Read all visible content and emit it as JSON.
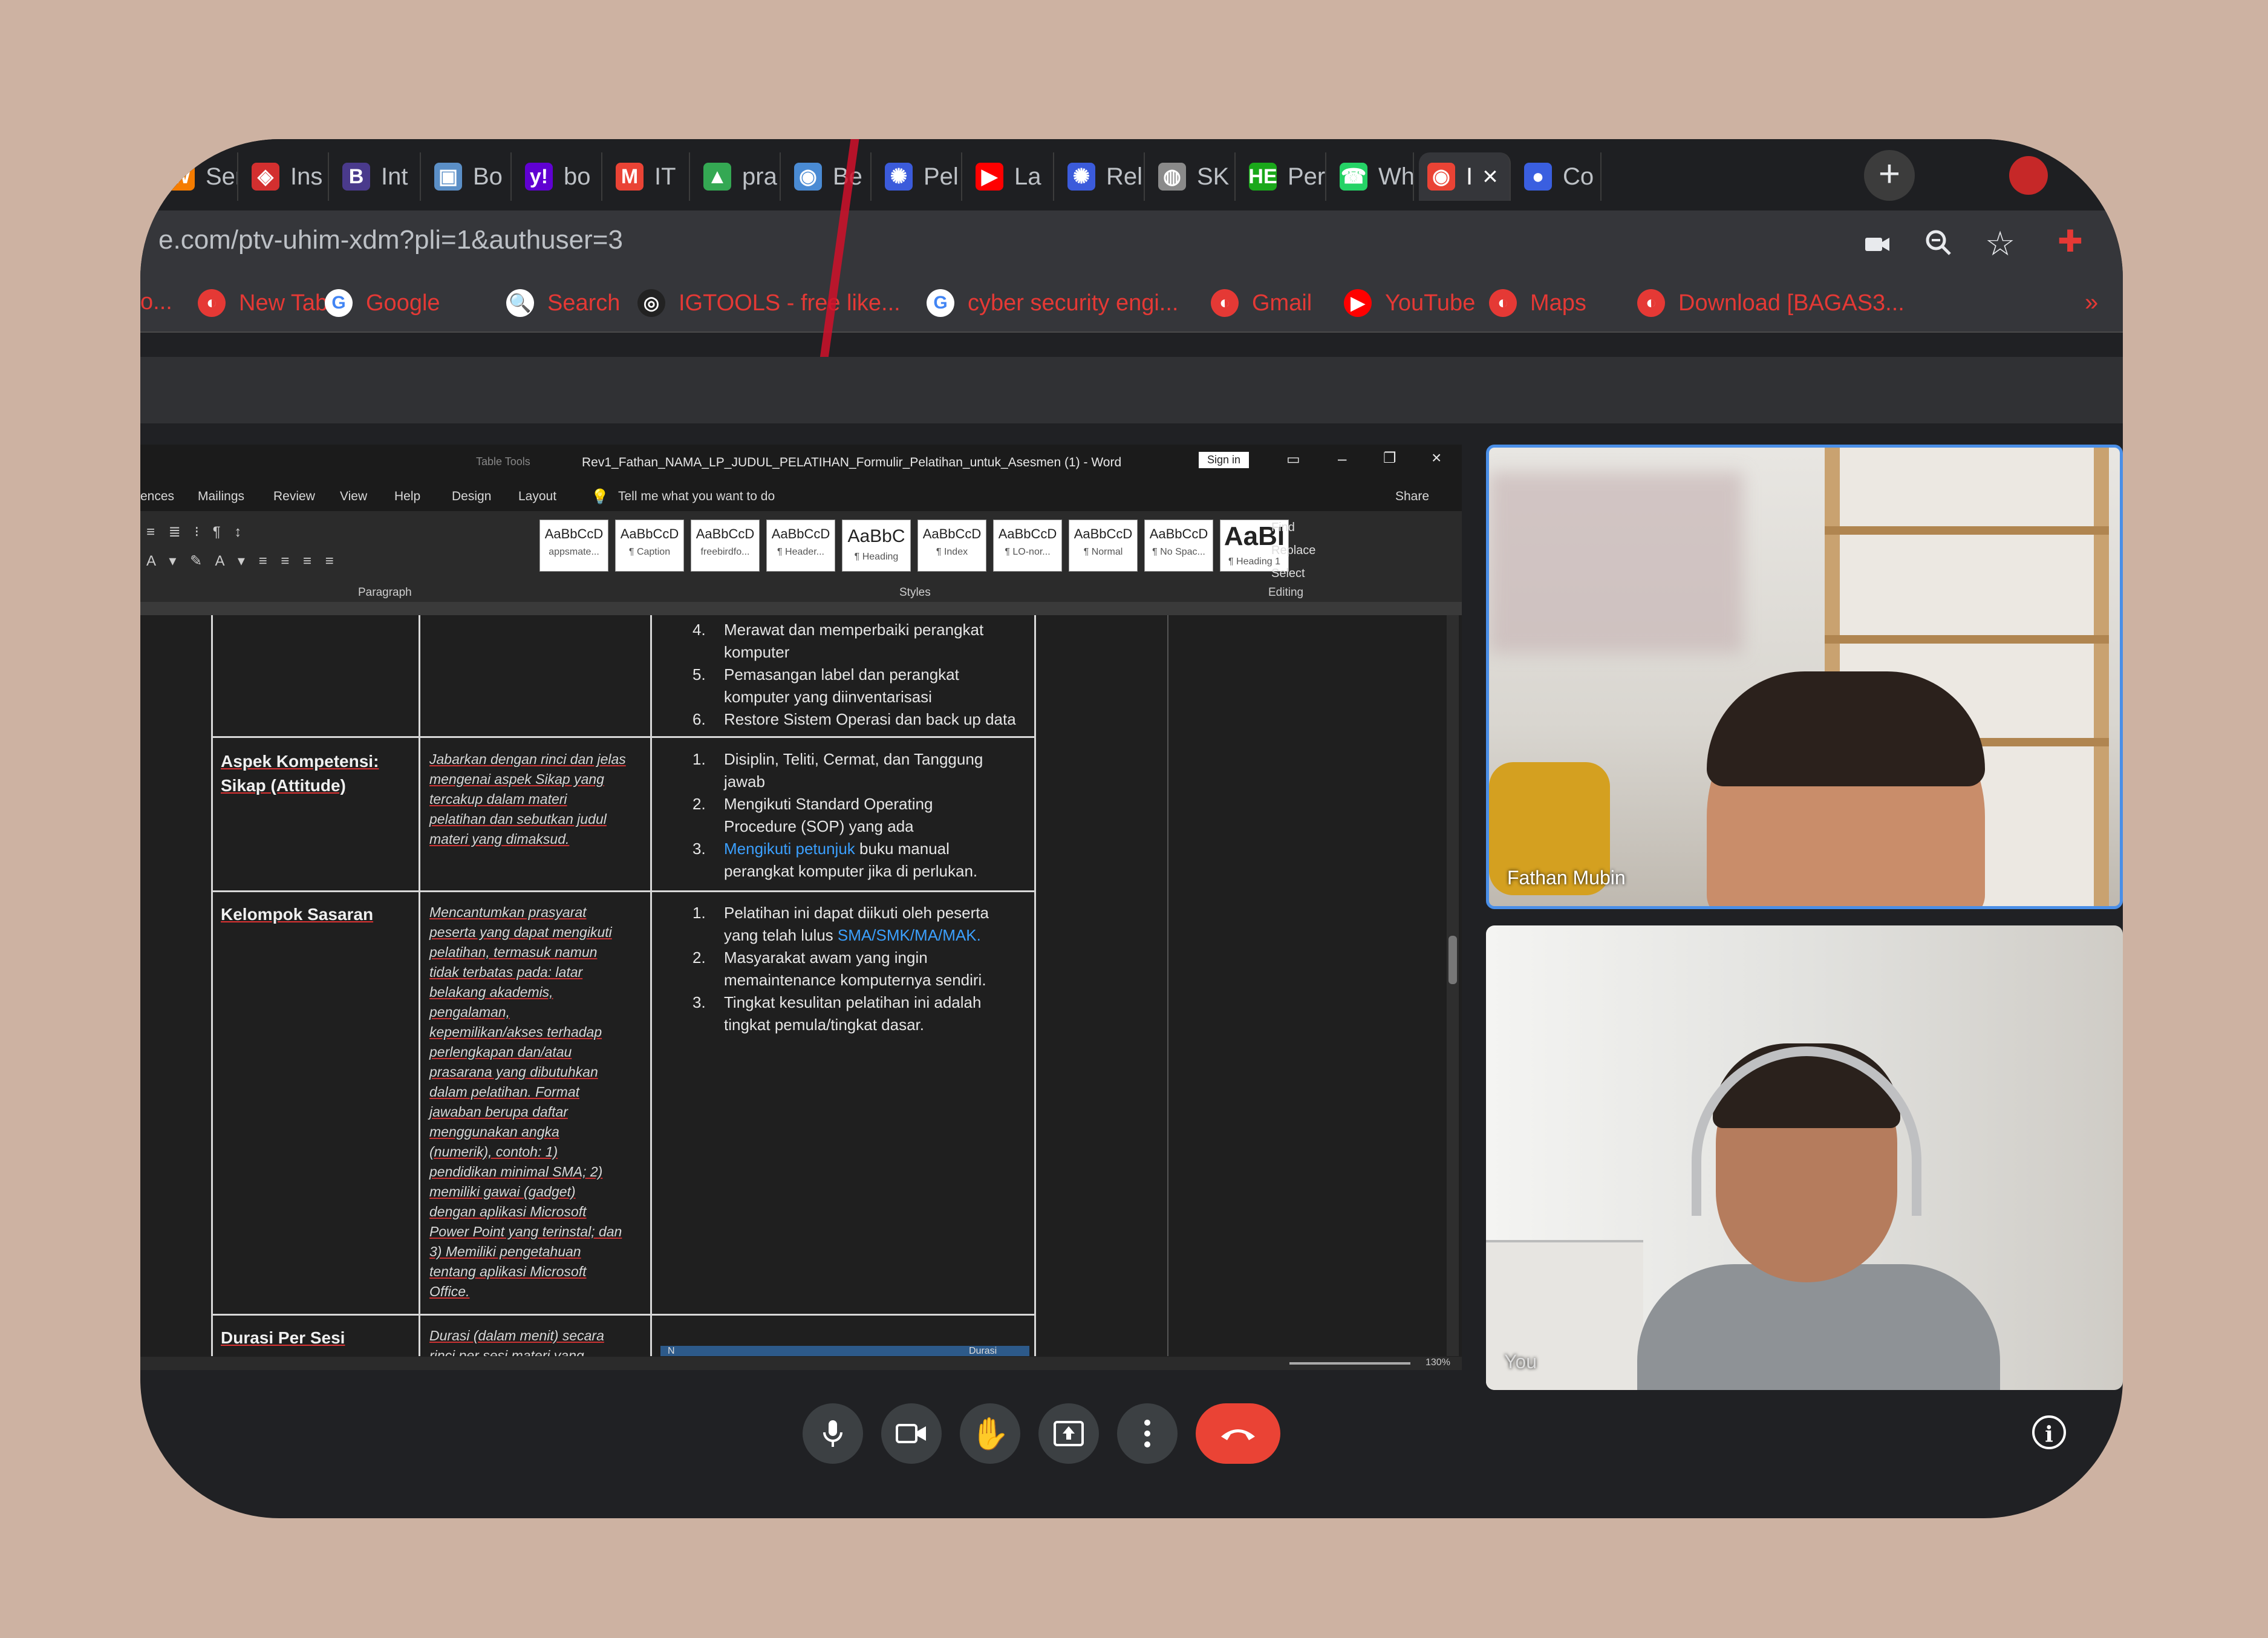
{
  "tabs": [
    {
      "label": "Ser",
      "icon": "ser-icon",
      "color": "#f57c00",
      "glyph": "W"
    },
    {
      "label": "Ins",
      "icon": "laravel-icon",
      "color": "#d32f2f",
      "glyph": "◈"
    },
    {
      "label": "Int",
      "icon": "bootstrap-icon",
      "color": "#4a3a8c",
      "glyph": "B"
    },
    {
      "label": "Bo",
      "icon": "box-icon",
      "color": "#5b8fc7",
      "glyph": "▣"
    },
    {
      "label": "bo",
      "icon": "yahoo-icon",
      "color": "#6001d2",
      "glyph": "y!"
    },
    {
      "label": "IT",
      "icon": "gmail-icon",
      "color": "#ea4335",
      "glyph": "M"
    },
    {
      "label": "pra",
      "icon": "drive-icon",
      "color": "#34a853",
      "glyph": "▲"
    },
    {
      "label": "Be",
      "icon": "maps-pin-icon",
      "color": "#4a8bd4",
      "glyph": "◉"
    },
    {
      "label": "Pel",
      "icon": "globe-blue-icon",
      "color": "#3b5bdb",
      "glyph": "✺"
    },
    {
      "label": "La",
      "icon": "youtube-icon",
      "color": "#ff0000",
      "glyph": "▶"
    },
    {
      "label": "Rel",
      "icon": "globe-blue-icon",
      "color": "#3b5bdb",
      "glyph": "✺"
    },
    {
      "label": "SK",
      "icon": "globe-gray-icon",
      "color": "#8a8a8a",
      "glyph": "◍"
    },
    {
      "label": "Per",
      "icon": "he-icon",
      "color": "#1aa81a",
      "glyph": "HE"
    },
    {
      "label": "Wh",
      "icon": "whatsapp-icon",
      "color": "#25d366",
      "glyph": "☎"
    },
    {
      "label": "I",
      "icon": "record-icon",
      "color": "#ea4335",
      "glyph": "◉",
      "active": true
    },
    {
      "label": "Co",
      "icon": "blob-icon",
      "color": "#3a5fe0",
      "glyph": "●"
    }
  ],
  "tab_close": "×",
  "new_tab": "+",
  "url": "e.com/ptv-uhim-xdm?pli=1&authuser=3",
  "bookmarks": [
    {
      "label": "o...",
      "icon": "",
      "color": ""
    },
    {
      "label": "New Tab",
      "icon": "globe-red-icon",
      "color": "#e53935"
    },
    {
      "label": "Google",
      "icon": "google-icon",
      "color": "#ffffff"
    },
    {
      "label": "Search",
      "icon": "search-icon",
      "color": "#ffffff"
    },
    {
      "label": "IGTOOLS - free like...",
      "icon": "igtools-icon",
      "color": "#222222"
    },
    {
      "label": "cyber security engi...",
      "icon": "google-icon",
      "color": "#ffffff"
    },
    {
      "label": "Gmail",
      "icon": "globe-red-icon",
      "color": "#e53935"
    },
    {
      "label": "YouTube",
      "icon": "youtube-icon",
      "color": "#ff0000"
    },
    {
      "label": "Maps",
      "icon": "globe-red-icon",
      "color": "#e53935"
    },
    {
      "label": "Download [BAGAS3...",
      "icon": "globe-red-icon",
      "color": "#e53935"
    }
  ],
  "bookmarks_more": "»",
  "word": {
    "title": "Rev1_Fathan_NAMA_LP_JUDUL_PELATIHAN_Formulir_Pelatihan_untuk_Asesmen (1) - Word",
    "table_tools": "Table Tools",
    "sign_in": "Sign in",
    "tabs": [
      "ences",
      "Mailings",
      "Review",
      "View",
      "Help",
      "Design",
      "Layout"
    ],
    "tell_me": "Tell me what you want to do",
    "share": "Share",
    "styles": [
      {
        "sample": "AaBbCcD",
        "name": "appsmate..."
      },
      {
        "sample": "AaBbCcD",
        "name": "¶ Caption"
      },
      {
        "sample": "AaBbCcD",
        "name": "freebirdfo..."
      },
      {
        "sample": "AaBbCcD",
        "name": "¶ Header..."
      },
      {
        "sample": "AaBbC",
        "name": "¶ Heading"
      },
      {
        "sample": "AaBbCcD",
        "name": "¶ Index"
      },
      {
        "sample": "AaBbCcD",
        "name": "¶ LO-nor..."
      },
      {
        "sample": "AaBbCcD",
        "name": "¶ Normal"
      },
      {
        "sample": "AaBbCcD",
        "name": "¶ No Spac..."
      },
      {
        "sample": "AaBI",
        "name": "¶ Heading 1"
      }
    ],
    "editing": {
      "find": "Find",
      "replace": "Replace",
      "select": "Select"
    },
    "group_labels": {
      "paragraph": "Paragraph",
      "styles": "Styles",
      "editing": "Editing"
    },
    "zoom": "130%",
    "doc": {
      "top_items": [
        {
          "n": "4.",
          "lines": [
            "Merawat dan memperbaiki perangkat",
            "komputer"
          ]
        },
        {
          "n": "5.",
          "lines": [
            "Pemasangan label dan perangkat",
            "komputer yang diinventarisasi"
          ]
        },
        {
          "n": "6.",
          "lines": [
            "Restore Sistem Operasi dan back up data"
          ]
        }
      ],
      "row_attitude": {
        "heading": [
          "Aspek Kompetensi:",
          "Sikap (Attitude)"
        ],
        "instruction": [
          "Jabarkan dengan rinci dan jelas",
          "mengenai aspek Sikap yang",
          "tercakup dalam materi",
          "pelatihan dan sebutkan judul",
          "materi yang dimaksud."
        ],
        "items": [
          {
            "n": "1.",
            "lines": [
              "Disiplin, Teliti, Cermat, dan Tanggung",
              "jawab"
            ]
          },
          {
            "n": "2.",
            "lines": [
              "Mengikuti Standard Operating",
              "Procedure (SOP) yang ada"
            ]
          },
          {
            "n": "3.",
            "link": "Mengikuti petunjuk",
            "rest": " buku manual",
            "line2": "perangkat komputer jika di perlukan."
          }
        ]
      },
      "row_sasaran": {
        "heading": [
          "Kelompok Sasaran"
        ],
        "instruction": [
          "Mencantumkan prasyarat",
          "peserta yang dapat mengikuti",
          "pelatihan, termasuk namun",
          "tidak terbatas pada: latar",
          "belakang akademis,",
          "pengalaman,",
          "kepemilikan/akses terhadap",
          "perlengkapan dan/atau",
          "prasarana yang dibutuhkan",
          "dalam pelatihan. Format",
          "jawaban berupa daftar",
          "menggunakan angka",
          "(numerik), contoh: 1)",
          "pendidikan minimal SMA; 2)",
          "memiliki gawai (gadget)",
          "dengan aplikasi Microsoft",
          "Power Point yang terinstal; dan",
          "3) Memiliki pengetahuan",
          "tentang aplikasi Microsoft",
          "Office."
        ],
        "item1_a": "Pelatihan ini  dapat  diikuti oleh peserta",
        "item1_b": "yang telah lulus ",
        "item1_link": "SMA/SMK/MA/MAK.",
        "items": [
          {
            "n": "2.",
            "lines": [
              "Masyarakat awam yang ingin",
              "memaintenance komputernya sendiri."
            ]
          },
          {
            "n": "3.",
            "lines": [
              "Tingkat  kesulitan  pelatihan  ini  adalah",
              "tingkat pemula/tingkat dasar."
            ]
          }
        ]
      },
      "row_durasi": {
        "heading": [
          "Durasi Per Sesi"
        ],
        "instruction": [
          "Durasi (dalam menit) secara",
          "rinci per sesi materi yang"
        ],
        "mini_header": [
          "N",
          "Durasi"
        ]
      }
    }
  },
  "participants": [
    {
      "name": "Fathan Mubin"
    },
    {
      "name": "You"
    }
  ],
  "controls": [
    "mic-button",
    "camera-button",
    "raise-hand-button",
    "present-button",
    "more-options-button",
    "end-call-button"
  ]
}
